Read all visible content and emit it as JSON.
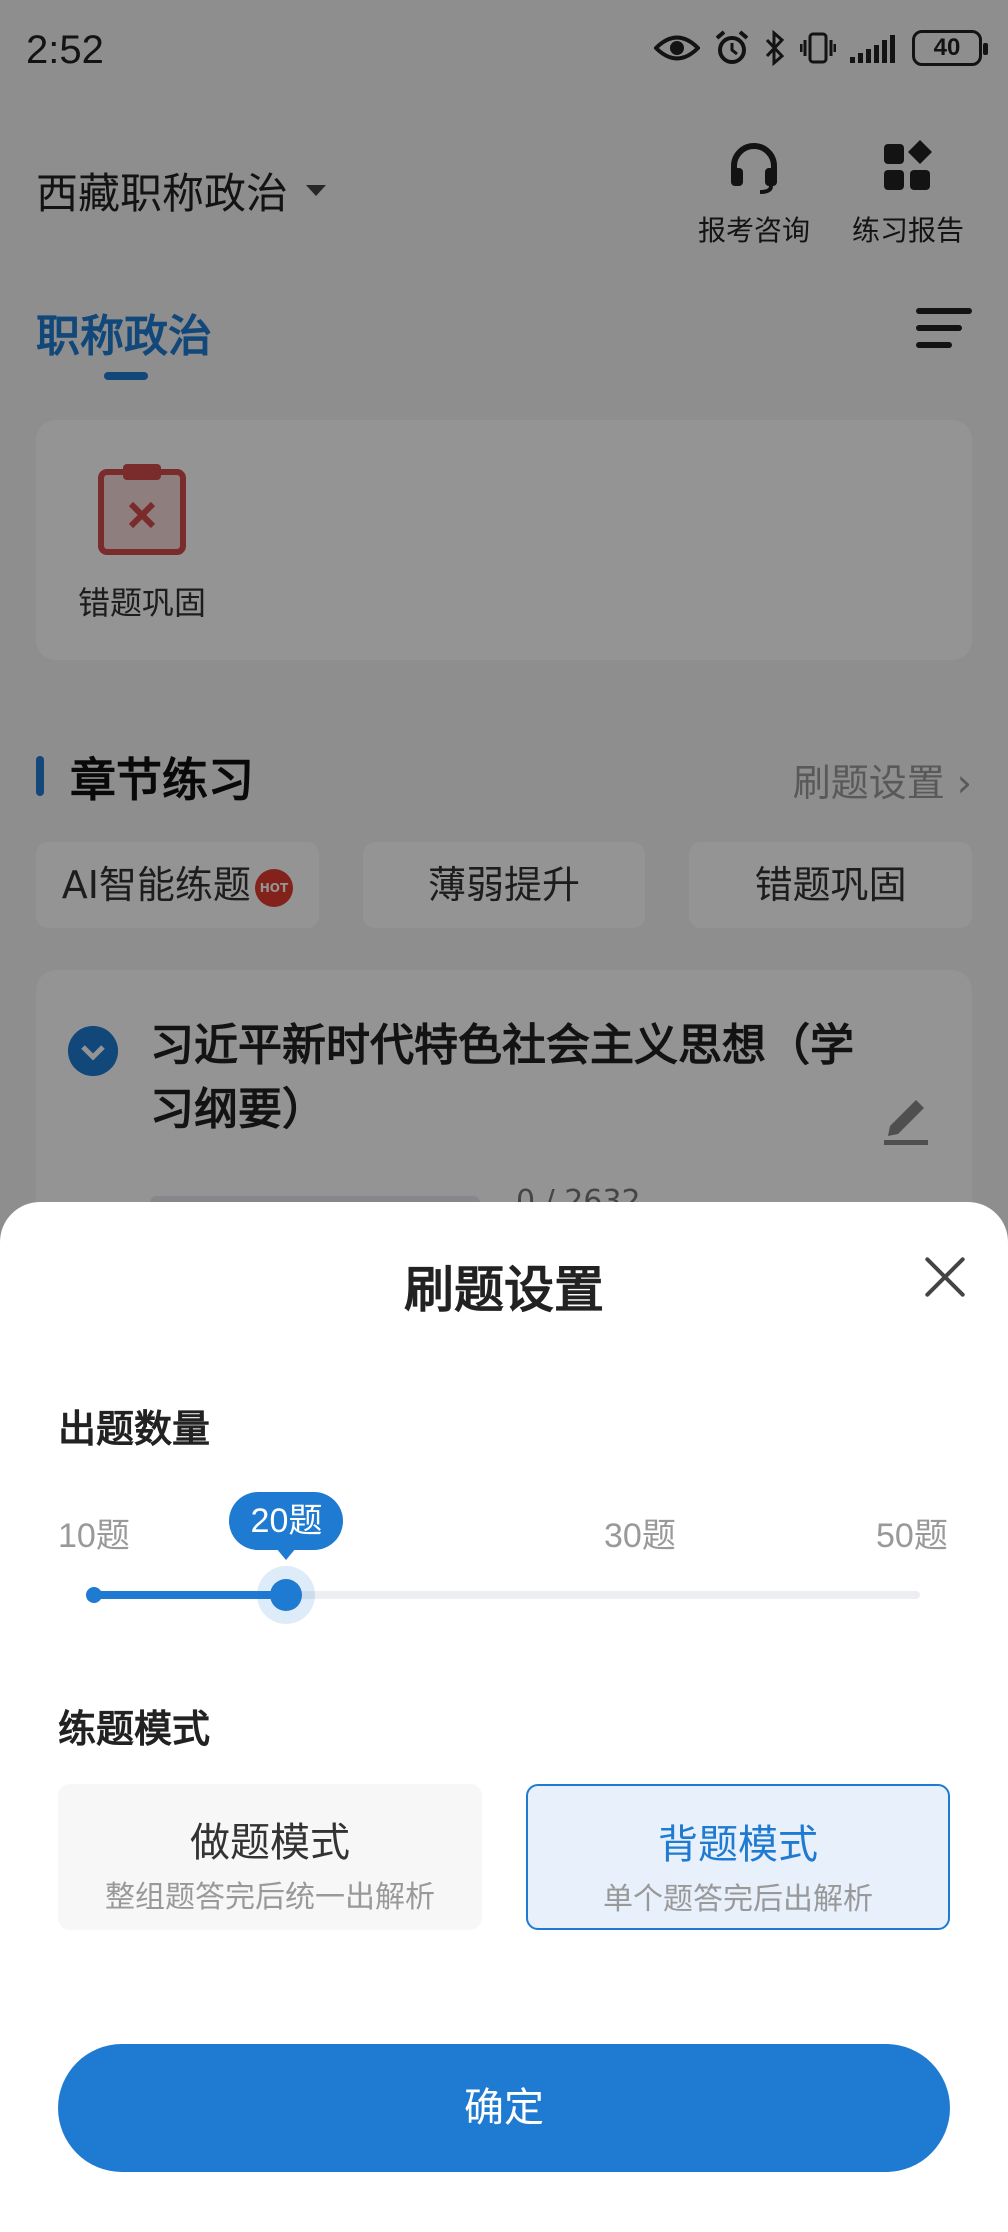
{
  "status_bar": {
    "time": "2:52",
    "battery": "40",
    "icons": [
      "eye-icon",
      "alarm-icon",
      "bluetooth-icon",
      "vibrate-icon",
      "signal-icon",
      "battery-icon"
    ]
  },
  "header": {
    "exam_name": "西藏职称政治",
    "consult_label": "报考咨询",
    "report_label": "练习报告"
  },
  "tabs": {
    "active": "职称政治"
  },
  "shortcuts": {
    "items": [
      {
        "label": "错题巩固",
        "icon": "wrong-questions-icon"
      }
    ]
  },
  "chapter_section": {
    "title": "章节练习",
    "settings_link": "刷题设置",
    "mode_tabs": [
      {
        "label": "AI智能练题",
        "badge": "HOT"
      },
      {
        "label": "薄弱提升"
      },
      {
        "label": "错题巩固"
      }
    ],
    "chapter": {
      "title": "习近平新时代特色社会主义思想（学习纲要）",
      "progress": "0 / 2632"
    }
  },
  "sheet": {
    "title": "刷题设置",
    "count_label": "出题数量",
    "count_options": [
      "10题",
      "20题",
      "30题",
      "50题"
    ],
    "count_selected": "20题",
    "slider_fraction": 0.233,
    "mode_label": "练题模式",
    "modes": [
      {
        "name": "做题模式",
        "desc": "整组题答完后统一出解析",
        "selected": false
      },
      {
        "name": "背题模式",
        "desc": "单个题答完后出解析",
        "selected": true
      }
    ],
    "confirm_label": "确定"
  },
  "colors": {
    "accent": "#1f7ad2",
    "hot_badge": "#e23b2e",
    "selected_card_bg": "#e7f0fb"
  }
}
